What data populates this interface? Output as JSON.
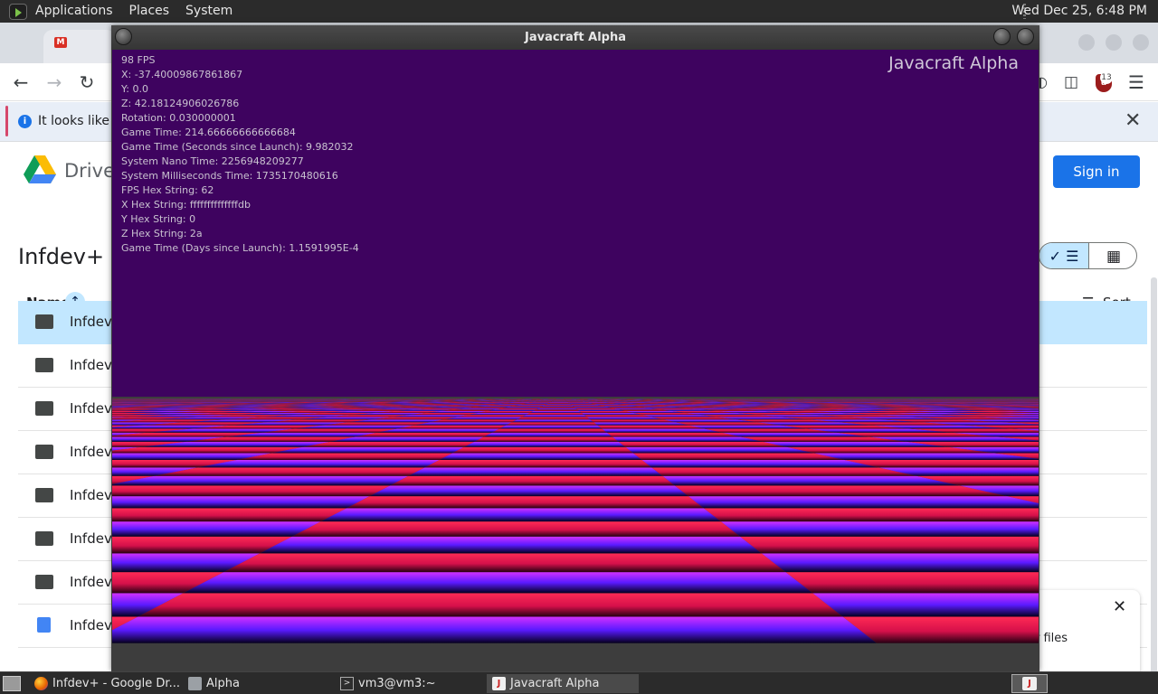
{
  "top_panel": {
    "menus": [
      "Applications",
      "Places",
      "System"
    ],
    "clock": "Wed Dec 25,  6:48 PM"
  },
  "background_app": {
    "info_bar_text": "It looks like yo",
    "drive_name": "Drive",
    "sign_in_label": "Sign in",
    "folder_title": "Infdev+",
    "name_column": "Name",
    "sort_label": "Sort",
    "extension_badge": "13",
    "rows": [
      {
        "name": "Infdev+",
        "icon": "shared-folder-icon",
        "selected": true
      },
      {
        "name": "Infdev+",
        "icon": "shared-folder-icon",
        "selected": false
      },
      {
        "name": "Infdev+",
        "icon": "shared-folder-icon",
        "selected": false
      },
      {
        "name": "Infdev+",
        "icon": "shared-folder-icon",
        "selected": false
      },
      {
        "name": "Infdev+",
        "icon": "shared-folder-icon",
        "selected": false
      },
      {
        "name": "Infdev+",
        "icon": "shared-folder-icon",
        "selected": false
      },
      {
        "name": "Infdev+",
        "icon": "shared-folder-icon",
        "selected": false
      },
      {
        "name": "Infdev+",
        "icon": "doc-icon",
        "selected": false
      }
    ],
    "toast_text": "r files"
  },
  "game_window": {
    "title": "Javacraft Alpha",
    "brand": "Javacraft Alpha",
    "hud_lines": [
      "98 FPS",
      "X: -37.40009867861867",
      "Y: 0.0",
      "Z: 42.18124906026786",
      "Rotation: 0.030000001",
      "Game Time: 214.66666666666684",
      "Game Time (Seconds since Launch): 9.982032",
      "System Nano Time: 2256948209277",
      "System Milliseconds Time: 1735170480616",
      "FPS Hex String: 62",
      "X Hex String: ffffffffffffffdb",
      "Y Hex String: 0",
      "Z Hex String: 2a",
      "Game Time (Days since Launch): 1.1591995E-4"
    ],
    "colors": {
      "sky": "#3e035f",
      "tile_a": "#ff1a40",
      "tile_b": "#7a1aff"
    }
  },
  "taskbar": {
    "tasks": [
      {
        "label": "Infdev+ - Google Dr...",
        "icon": "firefox-icon",
        "active": false
      },
      {
        "label": "Alpha",
        "icon": "folder-icon",
        "active": false
      },
      {
        "label": "vm3@vm3:~",
        "icon": "terminal-icon",
        "active": false
      },
      {
        "label": "Javacraft Alpha",
        "icon": "java-icon",
        "active": true
      }
    ]
  }
}
